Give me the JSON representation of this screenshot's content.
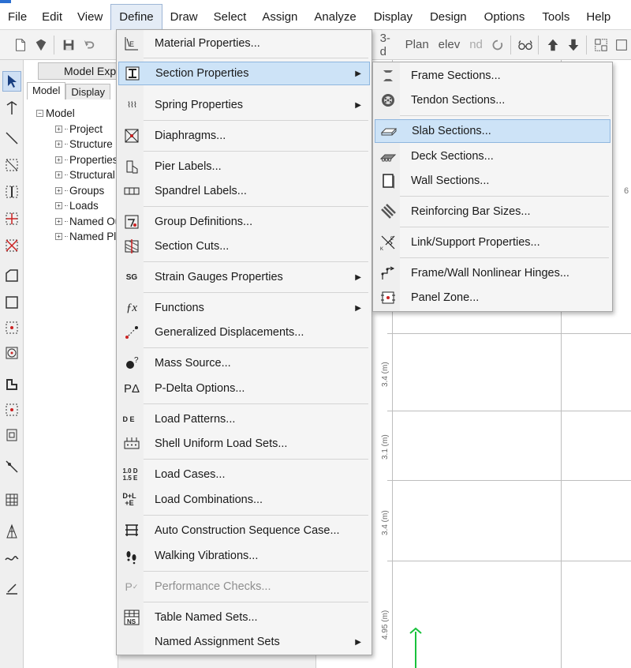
{
  "menubar": {
    "items": [
      "File",
      "Edit",
      "View",
      "Define",
      "Draw",
      "Select",
      "Assign",
      "Analyze",
      "Display",
      "Design",
      "Options",
      "Tools",
      "Help"
    ],
    "active": "Define"
  },
  "toolbar": {
    "view_3d": "3-d",
    "view_plan": "Plan",
    "view_elev": "elev",
    "view_nd": "nd"
  },
  "explorer": {
    "title": "Model Explorer",
    "tabs": [
      "Model",
      "Display"
    ],
    "tree_root": "Model",
    "tree_children": [
      "Project",
      "Structure",
      "Properties",
      "Structural",
      "Groups",
      "Loads",
      "Named Output",
      "Named Plots"
    ]
  },
  "canvas": {
    "dims": [
      "3.4 (m)",
      "3.1 (m)",
      "3.4 (m)",
      "4.95 (m)"
    ],
    "axis_label": "6"
  },
  "define_menu": {
    "items": [
      {
        "label": "Material Properties...",
        "icon": "material-icon",
        "submenu": false,
        "disabled": false
      },
      {
        "label": "Section Properties",
        "icon": "section-icon",
        "submenu": true,
        "disabled": false,
        "highlighted": true
      },
      {
        "label": "Spring Properties",
        "icon": "spring-icon",
        "submenu": true,
        "disabled": false
      },
      {
        "label": "Diaphragms...",
        "icon": "diaphragm-icon",
        "submenu": false,
        "disabled": false
      },
      {
        "label": "Pier Labels...",
        "icon": "pier-icon",
        "submenu": false,
        "disabled": false
      },
      {
        "label": "Spandrel Labels...",
        "icon": "spandrel-icon",
        "submenu": false,
        "disabled": false
      },
      {
        "label": "Group Definitions...",
        "icon": "group-icon",
        "submenu": false,
        "disabled": false
      },
      {
        "label": "Section Cuts...",
        "icon": "section-cut-icon",
        "submenu": false,
        "disabled": false
      },
      {
        "label": "Strain Gauges Properties",
        "icon": "strain-gauge-icon",
        "submenu": true,
        "disabled": false
      },
      {
        "label": "Functions",
        "icon": "function-icon",
        "submenu": true,
        "disabled": false
      },
      {
        "label": "Generalized Displacements...",
        "icon": "displacement-icon",
        "submenu": false,
        "disabled": false
      },
      {
        "label": "Mass Source...",
        "icon": "mass-icon",
        "submenu": false,
        "disabled": false
      },
      {
        "label": "P-Delta Options...",
        "icon": "pdelta-icon",
        "submenu": false,
        "disabled": false
      },
      {
        "label": "Load Patterns...",
        "icon": "load-pattern-icon",
        "submenu": false,
        "disabled": false
      },
      {
        "label": "Shell Uniform Load Sets...",
        "icon": "shell-load-icon",
        "submenu": false,
        "disabled": false
      },
      {
        "label": "Load Cases...",
        "icon": "load-case-icon",
        "submenu": false,
        "disabled": false
      },
      {
        "label": "Load Combinations...",
        "icon": "load-combo-icon",
        "submenu": false,
        "disabled": false
      },
      {
        "label": "Auto Construction Sequence Case...",
        "icon": "construction-icon",
        "submenu": false,
        "disabled": false
      },
      {
        "label": "Walking Vibrations...",
        "icon": "footprints-icon",
        "submenu": false,
        "disabled": false
      },
      {
        "label": "Performance Checks...",
        "icon": "performance-icon",
        "submenu": false,
        "disabled": true
      },
      {
        "label": "Table Named Sets...",
        "icon": "table-icon",
        "submenu": false,
        "disabled": false
      },
      {
        "label": "Named Assignment Sets",
        "icon": "assignment-icon",
        "submenu": true,
        "disabled": false
      }
    ],
    "icon_text": {
      "spring": "⌇⌇⌇",
      "strain": "SG",
      "func": "ƒx",
      "pdelta": "PΔ",
      "patterns": "D E",
      "cases": "1.0 D 1.5 E",
      "combos": "D+L +E",
      "perf": "P",
      "ns": "NS"
    }
  },
  "section_submenu": {
    "items": [
      {
        "label": "Frame Sections...",
        "icon": "frame-section-icon"
      },
      {
        "label": "Tendon Sections...",
        "icon": "tendon-icon"
      },
      {
        "label": "Slab Sections...",
        "icon": "slab-icon",
        "highlighted": true
      },
      {
        "label": "Deck Sections...",
        "icon": "deck-icon"
      },
      {
        "label": "Wall Sections...",
        "icon": "wall-icon"
      },
      {
        "label": "Reinforcing Bar Sizes...",
        "icon": "rebar-icon"
      },
      {
        "label": "Link/Support Properties...",
        "icon": "link-icon"
      },
      {
        "label": "Frame/Wall Nonlinear Hinges...",
        "icon": "hinge-icon"
      },
      {
        "label": "Panel Zone...",
        "icon": "panel-zone-icon"
      }
    ]
  }
}
